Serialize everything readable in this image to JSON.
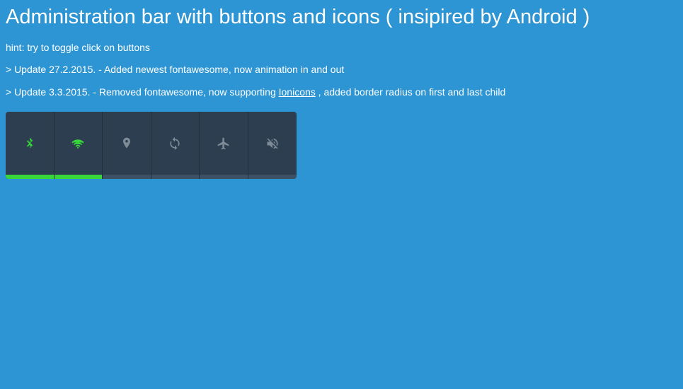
{
  "title": "Administration bar with buttons and icons ( insipired by Android )",
  "hint": "hint: try to toggle click on buttons",
  "update1": "> Update 27.2.2015. - Added newest fontawesome, now animation in and out",
  "update2_prefix": "> Update 3.3.2015. - Removed fontawesome, now supporting ",
  "update2_link": "Ionicons",
  "update2_suffix": " , added border radius on first and last child",
  "buttons": [
    {
      "name": "bluetooth",
      "active": true
    },
    {
      "name": "wifi",
      "active": true
    },
    {
      "name": "location",
      "active": false
    },
    {
      "name": "sync",
      "active": false
    },
    {
      "name": "airplane",
      "active": false
    },
    {
      "name": "volume-off",
      "active": false
    }
  ]
}
